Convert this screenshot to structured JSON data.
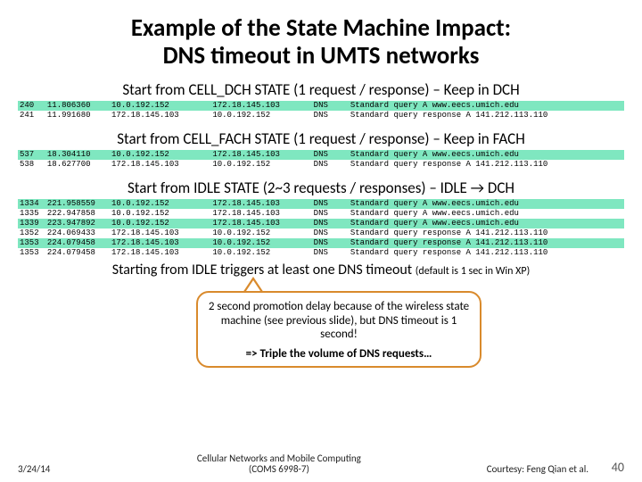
{
  "title_l1": "Example of the State Machine Impact:",
  "title_l2": "DNS timeout in UMTS networks",
  "section1": "Start from CELL_DCH STATE (1 request / response) – Keep in DCH",
  "section2": "Start from CELL_FACH STATE (1 request / response) – Keep in FACH",
  "section3": "Start from IDLE STATE (2~3 requests / responses) – IDLE → DCH",
  "caption_a": "Starting from IDLE triggers at least one DNS timeout ",
  "caption_b": "(default is 1 sec in Win XP)",
  "callout_p1": "2 second promotion delay because of the wireless state machine (see previous slide), but DNS timeout is 1 second!",
  "callout_p2": "=> Triple the volume of DNS requests…",
  "footer_date": "3/24/14",
  "footer_center_l1": "Cellular Networks and Mobile Computing",
  "footer_center_l2": "(COMS 6998-7)",
  "footer_courtesy": "Courtesy: Feng Qian et al.",
  "footer_page": "40",
  "trace1": [
    {
      "n": "240",
      "t": "11.806360",
      "src": "10.0.192.152",
      "dst": "172.18.145.103",
      "p": "DNS",
      "info": "Standard query A www.eecs.umich.edu"
    },
    {
      "n": "241",
      "t": "11.991680",
      "src": "172.18.145.103",
      "dst": "10.0.192.152",
      "p": "DNS",
      "info": "Standard query response A 141.212.113.110"
    }
  ],
  "trace2": [
    {
      "n": "537",
      "t": "18.304110",
      "src": "10.0.192.152",
      "dst": "172.18.145.103",
      "p": "DNS",
      "info": "Standard query A www.eecs.umich.edu"
    },
    {
      "n": "538",
      "t": "18.627700",
      "src": "172.18.145.103",
      "dst": "10.0.192.152",
      "p": "DNS",
      "info": "Standard query response A 141.212.113.110"
    }
  ],
  "trace3": [
    {
      "n": "1334",
      "t": "221.958559",
      "src": "10.0.192.152",
      "dst": "172.18.145.103",
      "p": "DNS",
      "info": "Standard query A www.eecs.umich.edu"
    },
    {
      "n": "1335",
      "t": "222.947858",
      "src": "10.0.192.152",
      "dst": "172.18.145.103",
      "p": "DNS",
      "info": "Standard query A www.eecs.umich.edu"
    },
    {
      "n": "1339",
      "t": "223.947892",
      "src": "10.0.192.152",
      "dst": "172.18.145.103",
      "p": "DNS",
      "info": "Standard query A www.eecs.umich.edu"
    },
    {
      "n": "1352",
      "t": "224.069433",
      "src": "172.18.145.103",
      "dst": "10.0.192.152",
      "p": "DNS",
      "info": "Standard query response A 141.212.113.110"
    },
    {
      "n": "1353",
      "t": "224.079458",
      "src": "172.18.145.103",
      "dst": "10.0.192.152",
      "p": "DNS",
      "info": "Standard query response A 141.212.113.110"
    },
    {
      "n": "1353",
      "t": "224.079458",
      "src": "172.18.145.103",
      "dst": "10.0.192.152",
      "p": "DNS",
      "info": "Standard query response A 141.212.113.110"
    }
  ]
}
